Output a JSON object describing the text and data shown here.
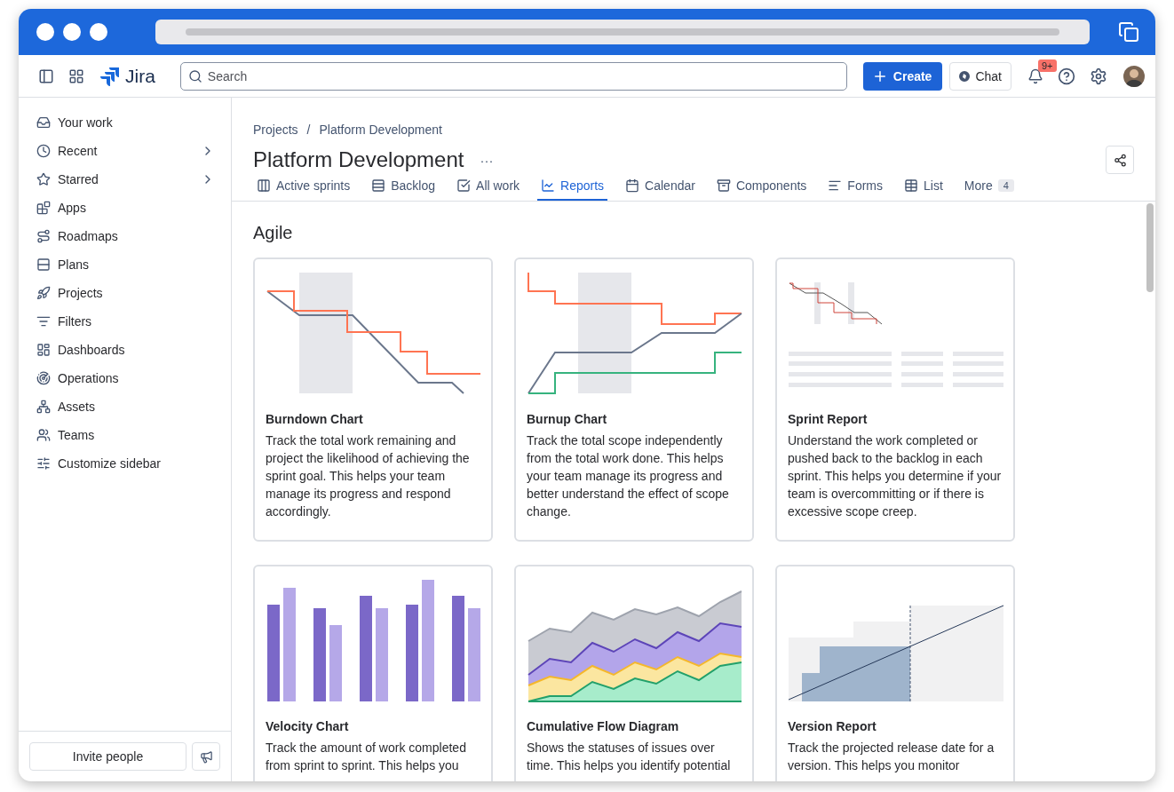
{
  "topbar": {
    "product": "Jira",
    "search": {
      "placeholder": "Search"
    },
    "create": "Create",
    "chat": "Chat",
    "notifications": "9+"
  },
  "sidebar": {
    "items": [
      {
        "label": "Your work",
        "has_submenu": false
      },
      {
        "label": "Recent",
        "has_submenu": true
      },
      {
        "label": "Starred",
        "has_submenu": true
      },
      {
        "label": "Apps",
        "has_submenu": false
      },
      {
        "label": "Roadmaps",
        "has_submenu": false
      },
      {
        "label": "Plans",
        "has_submenu": false
      },
      {
        "label": "Projects",
        "has_submenu": false
      },
      {
        "label": "Filters",
        "has_submenu": false
      },
      {
        "label": "Dashboards",
        "has_submenu": false
      },
      {
        "label": "Operations",
        "has_submenu": false
      },
      {
        "label": "Assets",
        "has_submenu": false
      },
      {
        "label": "Teams",
        "has_submenu": false
      },
      {
        "label": "Customize sidebar",
        "has_submenu": false
      }
    ],
    "invite": "Invite people"
  },
  "breadcrumbs": [
    "Projects",
    "/",
    "Platform Development"
  ],
  "title": "Platform Development",
  "title_menu": "···",
  "tabs": [
    {
      "label": "Active sprints",
      "selected": false
    },
    {
      "label": "Backlog",
      "selected": false
    },
    {
      "label": "All work",
      "selected": false
    },
    {
      "label": "Reports",
      "selected": true
    },
    {
      "label": "Calendar",
      "selected": false
    },
    {
      "label": "Components",
      "selected": false
    },
    {
      "label": "Forms",
      "selected": false
    },
    {
      "label": "List",
      "selected": false
    },
    {
      "label": "More",
      "selected": false,
      "count": "4"
    }
  ],
  "section": "Agile",
  "cards": [
    {
      "kind": "burndown",
      "title": "Burndown Chart",
      "description": "Track the total work remaining and project the likelihood of achieving the sprint goal. This helps your team manage its progress and respond accordingly."
    },
    {
      "kind": "burnup",
      "title": "Burnup Chart",
      "description": "Track the total scope independently from the total work done. This helps your team manage its progress and better understand the effect of scope change."
    },
    {
      "kind": "sprint",
      "title": "Sprint Report",
      "description": "Understand the work completed or pushed back to the backlog in each sprint. This helps you determine if your team is overcommitting or if there is excessive scope creep."
    },
    {
      "kind": "velocity",
      "title": "Velocity Chart",
      "description": "Track the amount of work completed from sprint to sprint. This helps you"
    },
    {
      "kind": "cfd",
      "title": "Cumulative Flow Diagram",
      "description": "Shows the statuses of issues over time. This helps you identify potential"
    },
    {
      "kind": "version",
      "title": "Version Report",
      "description": "Track the projected release date for a version. This helps you monitor"
    }
  ]
}
